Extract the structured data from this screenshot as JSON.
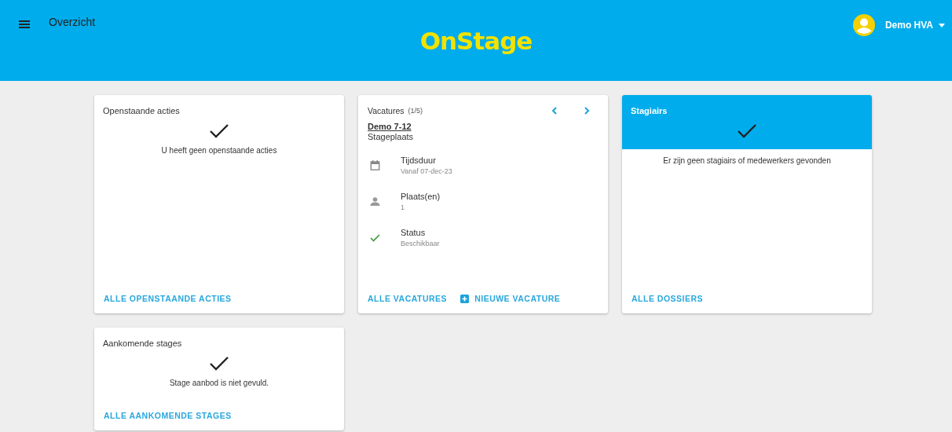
{
  "header": {
    "page_title": "Overzicht",
    "logo": "OnStage",
    "user": "Demo HVA"
  },
  "cards": [
    {
      "kind": "empty",
      "title": "Openstaande acties",
      "highlighted": false,
      "message": "U heeft geen openstaande acties",
      "links": [
        {
          "label": "ALLE OPENSTAANDE ACTIES",
          "icon": false
        }
      ]
    },
    {
      "kind": "vacancy",
      "title": "Vacatures",
      "counter": "(1/5)",
      "vacancy_name": "Demo 7-12",
      "vacancy_type": "Stageplaats",
      "details": [
        {
          "kind": "duration",
          "label": "Tijdsduur",
          "value": "Vanaf 07-dec-23"
        },
        {
          "kind": "places",
          "label": "Plaats(en)",
          "value": "1"
        },
        {
          "kind": "status",
          "label": "Status",
          "value": "Beschikbaar"
        }
      ],
      "links": [
        {
          "label": "ALLE VACATURES",
          "icon": false
        },
        {
          "label": "NIEUWE VACATURE",
          "icon": true
        }
      ]
    },
    {
      "kind": "empty",
      "title": "Stagiairs",
      "highlighted": true,
      "message": "Er zijn geen stagiairs of medewerkers gevonden",
      "links": [
        {
          "label": "ALLE DOSSIERS",
          "icon": false
        }
      ]
    },
    {
      "kind": "empty",
      "title": "Aankomende stages",
      "highlighted": false,
      "message": "Stage aanbod is niet gevuld.",
      "links": [
        {
          "label": "ALLE AANKOMENDE STAGES",
          "icon": false
        }
      ]
    }
  ]
}
